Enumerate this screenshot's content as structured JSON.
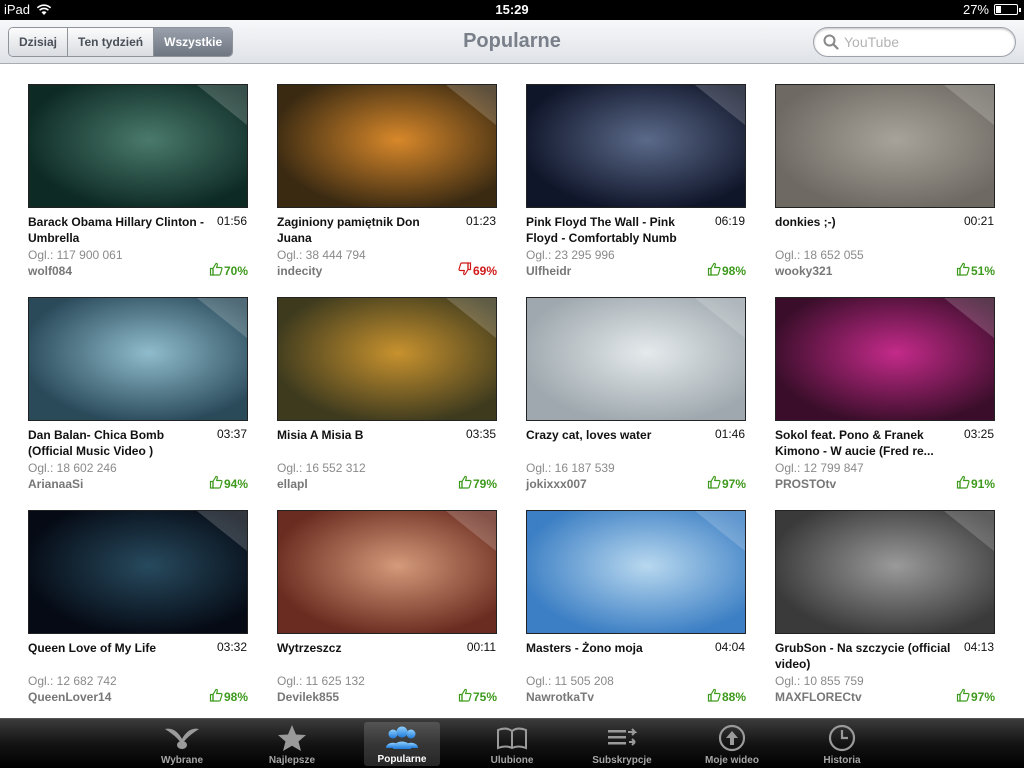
{
  "status": {
    "device": "iPad",
    "time": "15:29",
    "battery": "27%",
    "battery_level": 0.27
  },
  "nav": {
    "segments": [
      "Dzisiaj",
      "Ten tydzień",
      "Wszystkie"
    ],
    "active_segment": "Wszystkie",
    "title": "Popularne",
    "search_placeholder": "YouTube"
  },
  "videos": [
    {
      "title": "Barack Obama Hillary Clinton - Umbrella",
      "duration": "01:56",
      "views": "Ogl.: 117 900 061",
      "author": "wolf084",
      "rating": "70%",
      "rating_type": "up"
    },
    {
      "title": "Zaginiony pamiętnik Don Juana",
      "duration": "01:23",
      "views": "Ogl.: 38 444 794",
      "author": "indecity",
      "rating": "69%",
      "rating_type": "down"
    },
    {
      "title": "Pink Floyd The Wall - Pink Floyd - Comfortably Numb",
      "duration": "06:19",
      "views": "Ogl.: 23 295 996",
      "author": "Ulfheidr",
      "rating": "98%",
      "rating_type": "up"
    },
    {
      "title": "donkies ;-)",
      "duration": "00:21",
      "views": "Ogl.: 18 652 055",
      "author": "wooky321",
      "rating": "51%",
      "rating_type": "up"
    },
    {
      "title": "Dan Balan- Chica Bomb (Official Music Video )",
      "duration": "03:37",
      "views": "Ogl.: 18 602 246",
      "author": "ArianaaSi",
      "rating": "94%",
      "rating_type": "up"
    },
    {
      "title": "Misia A  Misia B",
      "duration": "03:35",
      "views": "Ogl.: 16 552 312",
      "author": "ellapl",
      "rating": "79%",
      "rating_type": "up"
    },
    {
      "title": "Crazy cat, loves water",
      "duration": "01:46",
      "views": "Ogl.: 16 187 539",
      "author": "jokixxx007",
      "rating": "97%",
      "rating_type": "up"
    },
    {
      "title": "Sokol feat. Pono & Franek Kimono - W aucie (Fred re...",
      "duration": "03:25",
      "views": "Ogl.: 12 799 847",
      "author": "PROSTOtv",
      "rating": "91%",
      "rating_type": "up"
    },
    {
      "title": "Queen Love of My Life",
      "duration": "03:32",
      "views": "Ogl.: 12 682 742",
      "author": "QueenLover14",
      "rating": "98%",
      "rating_type": "up"
    },
    {
      "title": "Wytrzeszcz",
      "duration": "00:11",
      "views": "Ogl.: 11 625 132",
      "author": "Devilek855",
      "rating": "75%",
      "rating_type": "up"
    },
    {
      "title": "Masters - Żono moja",
      "duration": "04:04",
      "views": "Ogl.: 11 505 208",
      "author": "NawrotkaTv",
      "rating": "88%",
      "rating_type": "up"
    },
    {
      "title": "GrubSon - Na szczycie (official video)",
      "duration": "04:13",
      "views": "Ogl.: 10 855 759",
      "author": "MAXFLORECtv",
      "rating": "97%",
      "rating_type": "up"
    }
  ],
  "thumb_colors": [
    [
      "#0d2a24",
      "#4a7a6c"
    ],
    [
      "#3a2a12",
      "#d8882a"
    ],
    [
      "#10162a",
      "#5b6a8a"
    ],
    [
      "#6e6a63",
      "#a8a39a"
    ],
    [
      "#2a4a5a",
      "#8fbccc"
    ],
    [
      "#3d3a1e",
      "#c8922e"
    ],
    [
      "#9ea8ae",
      "#e5eaec"
    ],
    [
      "#3a0e2a",
      "#c42a8a"
    ],
    [
      "#050a14",
      "#274a5e"
    ],
    [
      "#6a2c20",
      "#d49a7a"
    ],
    [
      "#3c7fc4",
      "#b8d8ef"
    ],
    [
      "#3a3a3a",
      "#9a9a9a"
    ]
  ],
  "tabs": [
    {
      "label": "Wybrane",
      "icon": "featured-icon"
    },
    {
      "label": "Najlepsze",
      "icon": "star-icon"
    },
    {
      "label": "Popularne",
      "icon": "people-icon",
      "active": true
    },
    {
      "label": "Ulubione",
      "icon": "book-icon"
    },
    {
      "label": "Subskrypcje",
      "icon": "subscriptions-icon"
    },
    {
      "label": "Moje wideo",
      "icon": "upload-icon"
    },
    {
      "label": "Historia",
      "icon": "clock-icon"
    }
  ]
}
